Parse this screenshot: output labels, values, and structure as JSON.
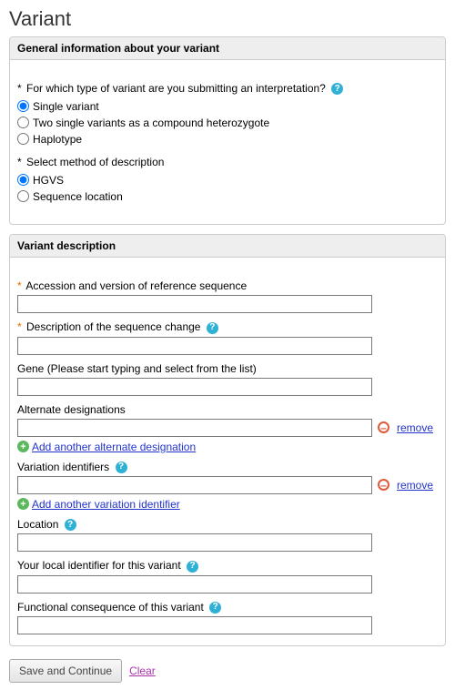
{
  "page_title": "Variant",
  "panel1": {
    "header": "General information about your variant",
    "q1_label": "For which type of variant are you submitting an interpretation?",
    "q1_options": [
      "Single variant",
      "Two single variants as a compound heterozygote",
      "Haplotype"
    ],
    "q1_selected_index": 0,
    "q2_label": "Select method of description",
    "q2_options": [
      "HGVS",
      "Sequence location"
    ],
    "q2_selected_index": 0
  },
  "panel2": {
    "header": "Variant description",
    "accession_label": "Accession and version of reference sequence",
    "description_label": "Description of the sequence change",
    "gene_label": "Gene (Please start typing and select from the list)",
    "alt_label": "Alternate designations",
    "add_alt_label": "Add another alternate designation",
    "varid_label": "Variation identifiers",
    "add_varid_label": "Add another variation identifier",
    "location_label": "Location",
    "localid_label": "Your local identifier for this variant",
    "func_label": "Functional consequence of this variant",
    "remove_label": "remove"
  },
  "buttons": {
    "save": "Save and Continue",
    "clear": "Clear"
  },
  "glyphs": {
    "help": "?",
    "plus": "+",
    "minus": "–"
  }
}
